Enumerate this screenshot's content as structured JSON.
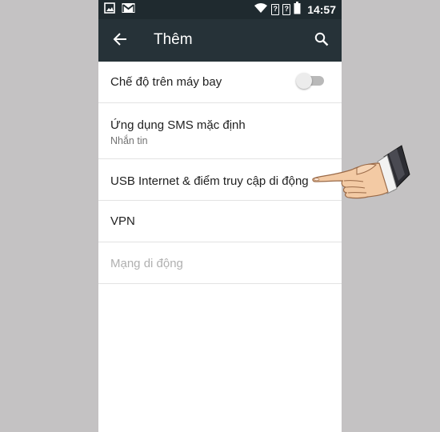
{
  "status_bar": {
    "time": "14:57",
    "sim1": "?",
    "sim2": "?",
    "icons": [
      "image-icon",
      "gmail-icon",
      "wifi-icon",
      "sim1-icon",
      "sim2-icon",
      "battery-icon"
    ]
  },
  "app_bar": {
    "title": "Thêm",
    "back_icon": "arrow-left-icon",
    "search_icon": "search-icon"
  },
  "settings": {
    "items": [
      {
        "title": "Chế độ trên máy bay",
        "toggle": false
      },
      {
        "title": "Ứng dụng SMS mặc định",
        "subtitle": "Nhắn tin"
      },
      {
        "title": "USB Internet & điểm truy cập di động"
      },
      {
        "title": "VPN"
      },
      {
        "title": "Mạng di động",
        "disabled": true
      }
    ]
  },
  "overlay": {
    "pointer_icon": "pointing-hand-icon"
  },
  "colors": {
    "status_bar": "#1f2a2f",
    "app_bar": "#263238",
    "background": "#c4c2c3",
    "divider": "#e3e3e3"
  }
}
